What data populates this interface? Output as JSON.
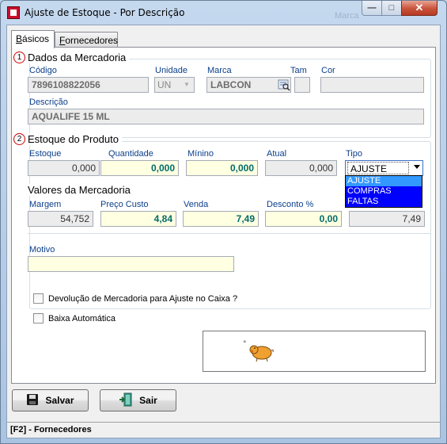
{
  "window": {
    "title": "Ajuste de Estoque - Por Descrição",
    "ghost_text": "Marca",
    "minimize_glyph": "—",
    "maximize_glyph": "□",
    "close_glyph": "✕"
  },
  "tabs": [
    {
      "label": "Básicos",
      "underline": "B",
      "rest": "ásicos"
    },
    {
      "label": "Fornecedores",
      "underline": "F",
      "rest": "ornecedores"
    }
  ],
  "section1": {
    "number": "1",
    "title": "Dados da Mercadoria",
    "codigo_label": "Código",
    "codigo_value": "7896108822056",
    "unidade_label": "Unidade",
    "unidade_value": "UN",
    "marca_label": "Marca",
    "marca_value": "LABCON",
    "tam_label": "Tam",
    "tam_value": "",
    "cor_label": "Cor",
    "cor_value": "",
    "descricao_label": "Descrição",
    "descricao_value": "AQUALIFE 15 ML"
  },
  "section2": {
    "number": "2",
    "title": "Estoque do Produto",
    "estoque_label": "Estoque",
    "estoque_value": "0,000",
    "quantidade_label": "Quantidade",
    "quantidade_value": "0,000",
    "minimo_label": "Mínino",
    "minimo_value": "0,000",
    "atual_label": "Atual",
    "atual_value": "0,000",
    "tipo_label": "Tipo",
    "tipo_value": "AJUSTE",
    "tipo_options": [
      "AJUSTE",
      "COMPRAS",
      "FALTAS"
    ]
  },
  "section3": {
    "title": "Valores da Mercadoria",
    "margem_label": "Margem",
    "margem_value": "54,752",
    "preco_label": "Preço Custo",
    "preco_value": "4,84",
    "venda_label": "Venda",
    "venda_value": "7,49",
    "desconto_label": "Desconto %",
    "desconto_value": "0,00",
    "final_value": "7,49"
  },
  "motivo": {
    "label": "Motivo",
    "value": ""
  },
  "checkboxes": {
    "devolucao": "Devolução de Mercadoria para Ajuste no Caixa ?",
    "baixa": "Baixa Automática"
  },
  "buttons": {
    "salvar": "Salvar",
    "sair": "Sair"
  },
  "status": {
    "text": "[F2] - Fornecedores"
  }
}
